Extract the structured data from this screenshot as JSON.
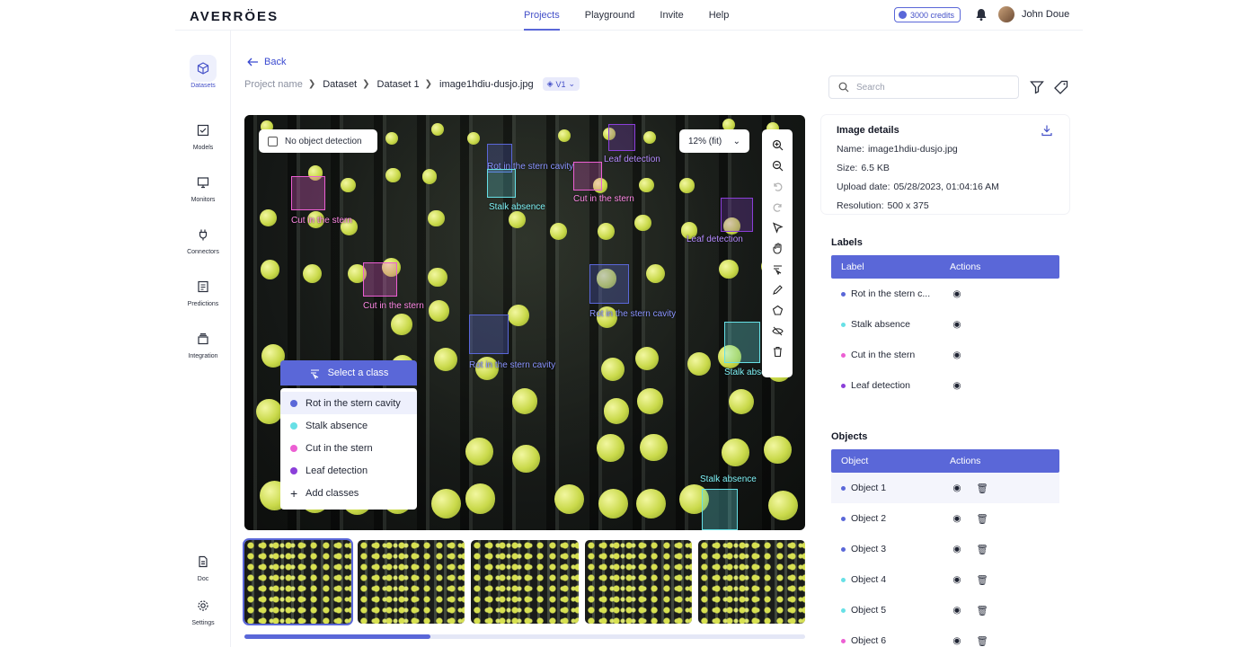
{
  "brand": {
    "logo": "AVERRÖES"
  },
  "nav": {
    "items": [
      {
        "label": "Projects",
        "active": true
      },
      {
        "label": "Playground"
      },
      {
        "label": "Invite"
      },
      {
        "label": "Help"
      }
    ]
  },
  "header": {
    "credits": "3000 credits",
    "user": "John Doue"
  },
  "sidebar": {
    "items": [
      {
        "label": "Datasets",
        "icon": "cube-icon",
        "active": true
      },
      {
        "label": "Models",
        "icon": "check-square-icon"
      },
      {
        "label": "Monitors",
        "icon": "monitor-icon"
      },
      {
        "label": "Connectors",
        "icon": "plug-icon"
      },
      {
        "label": "Predictions",
        "icon": "list-icon"
      },
      {
        "label": "Integration",
        "icon": "stack-icon"
      },
      {
        "label": "Doc",
        "icon": "document-icon"
      },
      {
        "label": "Settings",
        "icon": "gear-icon"
      }
    ]
  },
  "page": {
    "back": "Back",
    "breadcrumb": [
      "Project name",
      "Dataset",
      "Dataset 1",
      "image1hdiu-dusjo.jpg"
    ],
    "version": "V1"
  },
  "canvas": {
    "no_detection": "No object detection",
    "zoom": "12% (fit)",
    "select_class": "Select a class",
    "classes": [
      {
        "label": "Rot in the stern cavity",
        "color": "#5a67d8",
        "selected": true
      },
      {
        "label": "Stalk absence",
        "color": "#67e0e6"
      },
      {
        "label": "Cut in the stern",
        "color": "#ec5fd3"
      },
      {
        "label": "Leaf detection",
        "color": "#8b3fd9"
      }
    ],
    "add_classes": "Add classes",
    "annotations": [
      "Leaf detection",
      "Rot in the stern cavity",
      "Cut in the stern",
      "Stalk absence",
      "Cut in the stern",
      "Leaf detection",
      "Cut in the stern",
      "Rot in the stern cavity",
      "Rot in the stern cavity",
      "Stalk absence",
      "Stalk absence"
    ]
  },
  "right": {
    "search_placeholder": "Search",
    "details": {
      "title": "Image details",
      "name_label": "Name:",
      "name": "image1hdiu-dusjo.jpg",
      "size_label": "Size:",
      "size": "6.5 KB",
      "upload_label": "Upload date:",
      "upload": "05/28/2023, 01:04:16 AM",
      "res_label": "Resolution:",
      "res": "500 x 375"
    },
    "labels": {
      "title": "Labels",
      "col1": "Label",
      "col2": "Actions",
      "rows": [
        {
          "label": "Rot in the stern c...",
          "color": "#5a67d8"
        },
        {
          "label": "Stalk absence",
          "color": "#67e0e6"
        },
        {
          "label": "Cut in the stern",
          "color": "#ec5fd3"
        },
        {
          "label": "Leaf detection",
          "color": "#8b3fd9"
        }
      ]
    },
    "objects": {
      "title": "Objects",
      "col1": "Object",
      "col2": "Actions",
      "rows": [
        {
          "label": "Object 1",
          "color": "#5a67d8"
        },
        {
          "label": "Object 2",
          "color": "#5a67d8"
        },
        {
          "label": "Object 3",
          "color": "#5a67d8"
        },
        {
          "label": "Object 4",
          "color": "#67e0e6"
        },
        {
          "label": "Object 5",
          "color": "#67e0e6"
        },
        {
          "label": "Object 6",
          "color": "#ec5fd3"
        }
      ]
    }
  },
  "thumbnails": {
    "count": 5,
    "scroll_progress": 0.33
  }
}
